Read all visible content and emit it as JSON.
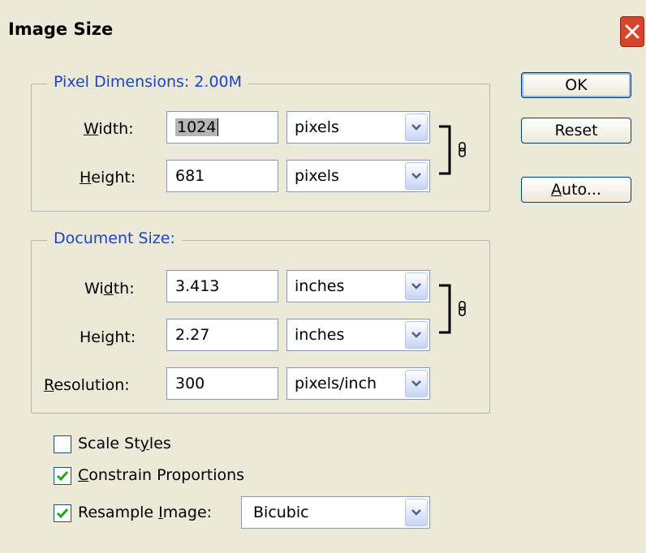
{
  "window": {
    "title": "Image Size"
  },
  "buttons": {
    "ok": "OK",
    "reset": "Reset",
    "auto_before": "",
    "auto_u": "A",
    "auto_after": "uto..."
  },
  "pixel_dimensions": {
    "legend": "Pixel Dimensions:  2.00M",
    "width": {
      "label_u": "W",
      "label_rest": "idth:",
      "value": "1024",
      "unit": "pixels"
    },
    "height": {
      "label_u": "H",
      "label_rest": "eight:",
      "value": "681",
      "unit": "pixels"
    }
  },
  "document_size": {
    "legend": "Document Size:",
    "width": {
      "label_pre": "Wi",
      "label_u": "d",
      "label_rest": "th:",
      "value": "3.413",
      "unit": "inches"
    },
    "height": {
      "label_pre": "Hei",
      "label_u": "g",
      "label_rest": "ht:",
      "value": "2.27",
      "unit": "inches"
    },
    "resolution": {
      "label_u": "R",
      "label_rest": "esolution:",
      "value": "300",
      "unit": "pixels/inch"
    }
  },
  "options": {
    "scale_styles": {
      "pre": "Scale St",
      "u": "y",
      "rest": "les",
      "checked": false
    },
    "constrain": {
      "u": "C",
      "rest": "onstrain Proportions",
      "checked": true
    },
    "resample": {
      "pre": "Resample ",
      "u": "I",
      "rest": "mage:",
      "checked": true,
      "method": "Bicubic"
    }
  },
  "colors": {
    "legend": "#1a45c6",
    "dialog_bg": "#ece9d8",
    "close": "#d7442a"
  },
  "icons": {
    "close": "close-icon",
    "dropdown": "chevron-down-icon",
    "link": "chain-link-icon",
    "check": "checkmark-icon"
  }
}
